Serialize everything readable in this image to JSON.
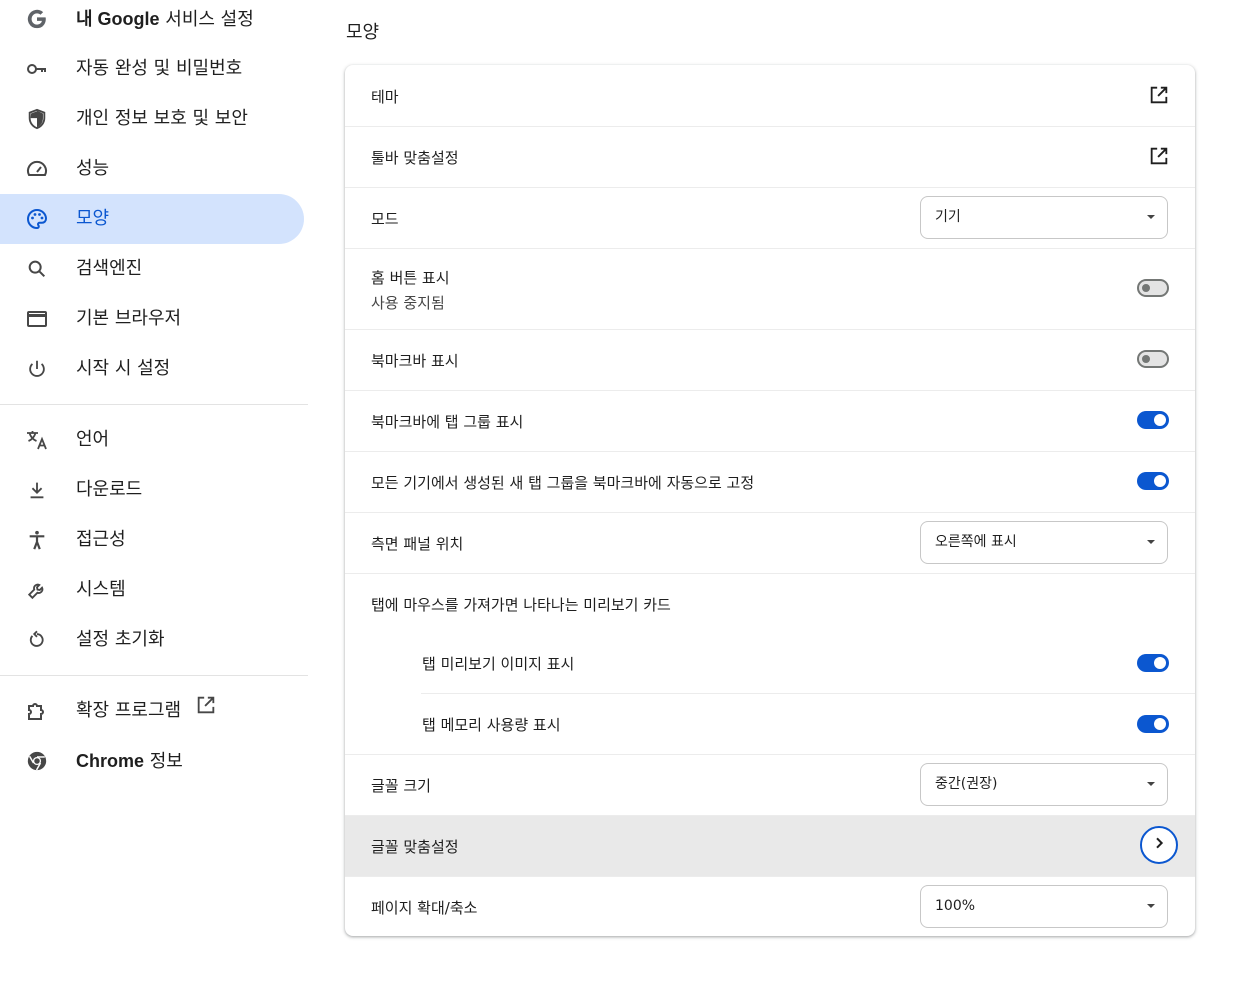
{
  "sidebar": {
    "items": [
      {
        "id": "google-services",
        "label_bold": "내 Google",
        "label": " 서비스 설정",
        "icon": "google-g-icon"
      },
      {
        "id": "autofill",
        "label": "자동 완성 및 비밀번호",
        "icon": "key-icon"
      },
      {
        "id": "privacy",
        "label": "개인 정보 보호 및 보안",
        "icon": "shield-icon"
      },
      {
        "id": "performance",
        "label": "성능",
        "icon": "gauge-icon"
      },
      {
        "id": "appearance",
        "label": "모양",
        "icon": "palette-icon",
        "active": true
      },
      {
        "id": "search-engine",
        "label": "검색엔진",
        "icon": "search-icon"
      },
      {
        "id": "default-browser",
        "label": "기본 브라우저",
        "icon": "browser-window-icon"
      },
      {
        "id": "on-startup",
        "label": "시작 시 설정",
        "icon": "power-icon"
      },
      {
        "id": "languages",
        "label": "언어",
        "icon": "translate-icon"
      },
      {
        "id": "downloads",
        "label": "다운로드",
        "icon": "download-icon"
      },
      {
        "id": "accessibility",
        "label": "접근성",
        "icon": "accessibility-icon"
      },
      {
        "id": "system",
        "label": "시스템",
        "icon": "wrench-icon"
      },
      {
        "id": "reset",
        "label": "설정 초기화",
        "icon": "reset-icon"
      },
      {
        "id": "extensions",
        "label": "확장 프로그램",
        "icon": "puzzle-icon"
      },
      {
        "id": "about",
        "label_bold": "Chrome",
        "label": " 정보",
        "icon": "chrome-icon"
      }
    ]
  },
  "main": {
    "title": "모양",
    "rows": {
      "theme": {
        "label": "테마"
      },
      "toolbar": {
        "label": "툴바 맞춤설정"
      },
      "mode": {
        "label": "모드",
        "value": "기기"
      },
      "home_button": {
        "label": "홈 버튼 표시",
        "sublabel": "사용 중지됨",
        "on": false
      },
      "bookmarks_bar": {
        "label": "북마크바 표시",
        "on": false
      },
      "bookmarks_tab_groups": {
        "label": "북마크바에 탭 그룹 표시",
        "on": true
      },
      "auto_pin": {
        "label": "모든 기기에서 생성된 새 탭 그룹을 북마크바에 자동으로 고정",
        "on": true
      },
      "side_panel": {
        "label": "측면 패널 위치",
        "value": "오른쪽에 표시"
      },
      "hover_card": {
        "label": "탭에 마우스를 가져가면 나타나는 미리보기 카드"
      },
      "hover_image": {
        "label": "탭 미리보기 이미지 표시",
        "on": true
      },
      "hover_memory": {
        "label": "탭 메모리 사용량 표시",
        "on": true
      },
      "font_size": {
        "label": "글꼴 크기",
        "value": "중간(권장)"
      },
      "customize_fonts": {
        "label": "글꼴 맞춤설정"
      },
      "page_zoom": {
        "label": "페이지 확대/축소",
        "value": "100%"
      }
    }
  },
  "colors": {
    "accent": "#0b57d0",
    "active_bg": "#d3e3fd",
    "hover_row": "#e9e9e9"
  }
}
